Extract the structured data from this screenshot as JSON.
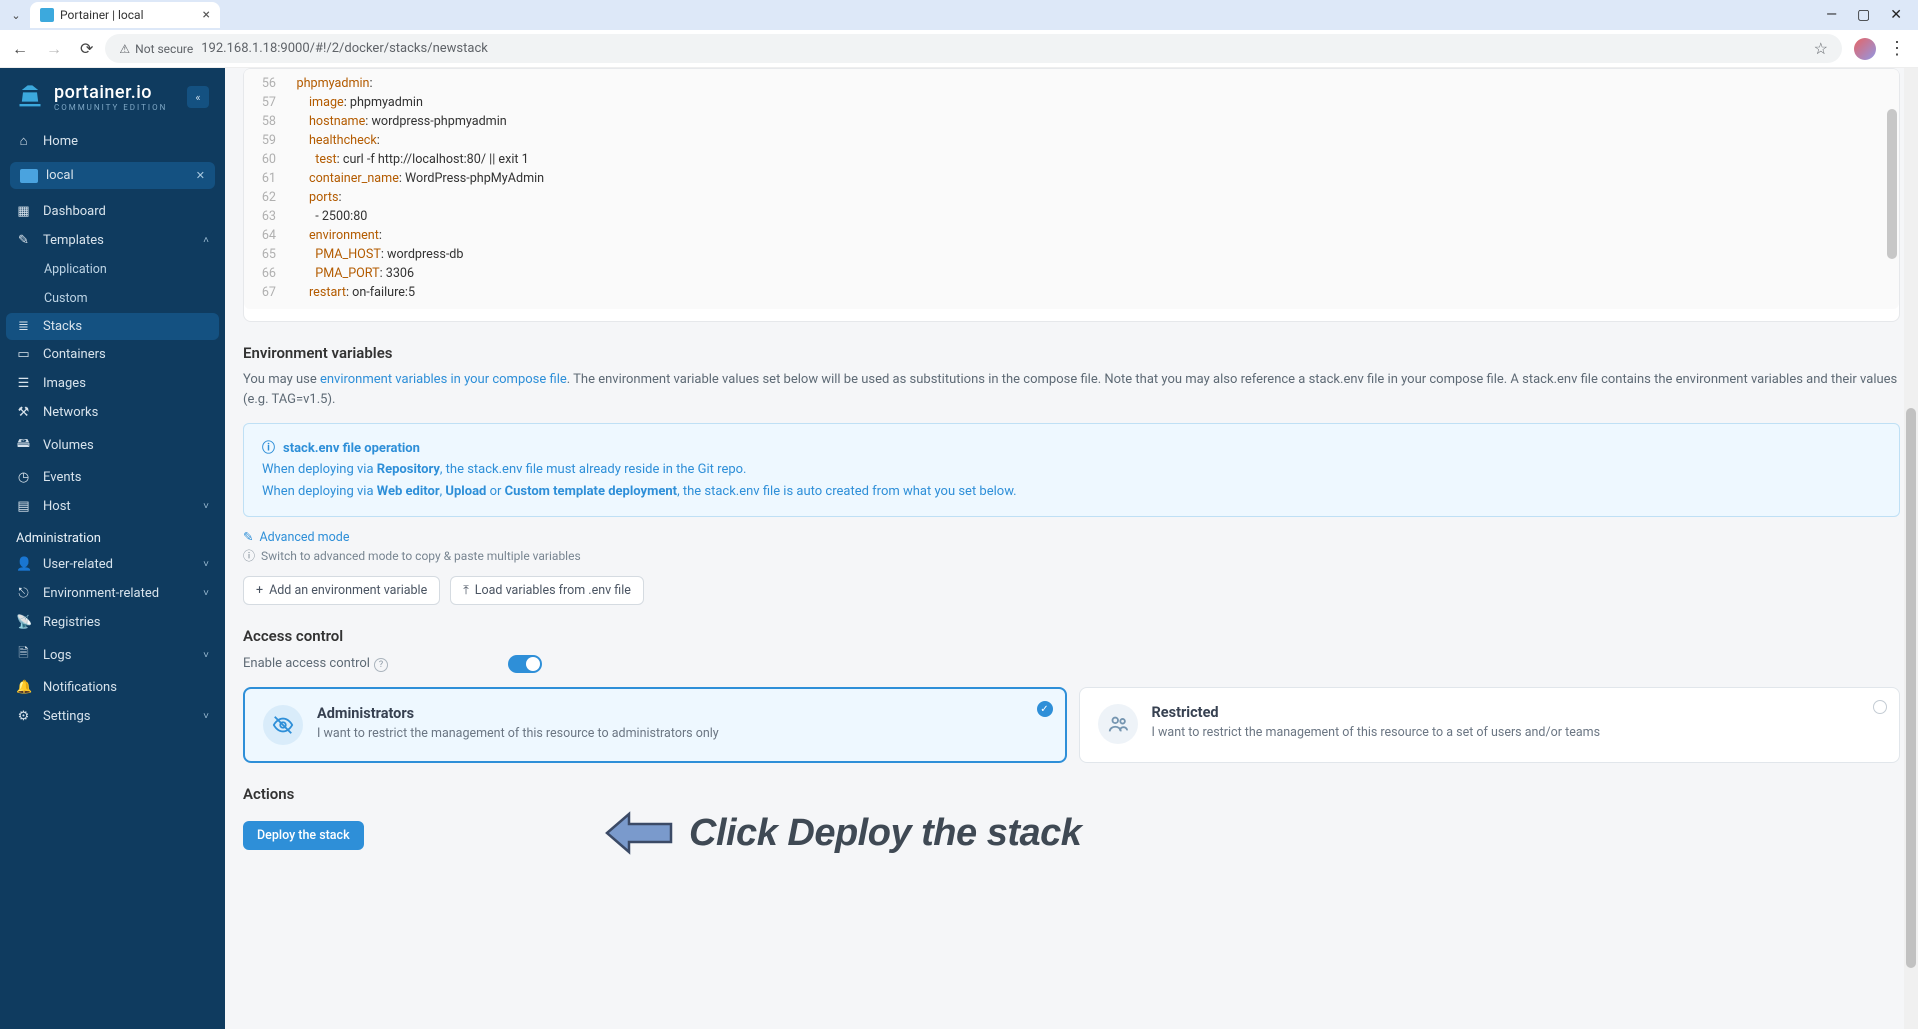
{
  "browser": {
    "tab_title": "Portainer | local",
    "security": "Not secure",
    "url": "192.168.1.18:9000/#!/2/docker/stacks/newstack"
  },
  "brand": {
    "name": "portainer.io",
    "edition": "COMMUNITY EDITION"
  },
  "sidebar": {
    "home": "Home",
    "env": "local",
    "items": [
      "Dashboard",
      "Templates",
      "Application",
      "Custom",
      "Stacks",
      "Containers",
      "Images",
      "Networks",
      "Volumes",
      "Events",
      "Host"
    ],
    "admin_title": "Administration",
    "admin_items": [
      "User-related",
      "Environment-related",
      "Registries",
      "Logs",
      "Notifications",
      "Settings"
    ]
  },
  "code": {
    "lines": [
      {
        "n": 56,
        "k": "phpmyadmin",
        "v": ":"
      },
      {
        "n": 57,
        "k": "image",
        "v": ": phpmyadmin"
      },
      {
        "n": 58,
        "k": "hostname",
        "v": ": wordpress-phpmyadmin"
      },
      {
        "n": 59,
        "k": "healthcheck",
        "v": ":"
      },
      {
        "n": 60,
        "k": "test",
        "v": ": curl -f http://localhost:80/ || exit 1"
      },
      {
        "n": 61,
        "k": "container_name",
        "v": ": WordPress-phpMyAdmin"
      },
      {
        "n": 62,
        "k": "ports",
        "v": ":"
      },
      {
        "n": 63,
        "k": "",
        "v": "  - 2500:80"
      },
      {
        "n": 64,
        "k": "environment",
        "v": ":"
      },
      {
        "n": 65,
        "k": "PMA_HOST",
        "v": ": wordpress-db"
      },
      {
        "n": 66,
        "k": "PMA_PORT",
        "v": ": 3306"
      },
      {
        "n": 67,
        "k": "restart",
        "v": ": on-failure:5"
      }
    ]
  },
  "env_section": {
    "title": "Environment variables",
    "desc_pre": "You may use ",
    "desc_link": "environment variables in your compose file",
    "desc_post": ". The environment variable values set below will be used as substitutions in the compose file. Note that you may also reference a stack.env file in your compose file. A stack.env file contains the environment variables and their values (e.g. TAG=v1.5).",
    "info_title": "stack.env file operation",
    "info_l1_a": "When deploying via ",
    "info_l1_b": "Repository",
    "info_l1_c": ", the stack.env file must already reside in the Git repo.",
    "info_l2_a": "When deploying via ",
    "info_l2_b": "Web editor",
    "info_l2_c": ", ",
    "info_l2_d": "Upload",
    "info_l2_e": " or ",
    "info_l2_f": "Custom template deployment",
    "info_l2_g": ", the stack.env file is auto created from what you set below.",
    "adv_mode": "Advanced mode",
    "adv_sub": "Switch to advanced mode to copy & paste multiple variables",
    "btn_add": "Add an environment variable",
    "btn_load": "Load variables from .env file"
  },
  "access": {
    "title": "Access control",
    "enable": "Enable access control",
    "opt1_title": "Administrators",
    "opt1_desc": "I want to restrict the management of this resource to administrators only",
    "opt2_title": "Restricted",
    "opt2_desc": "I want to restrict the management of this resource to a set of users and/or teams"
  },
  "actions": {
    "title": "Actions",
    "deploy": "Deploy the stack"
  },
  "annotation": "Click Deploy the stack"
}
